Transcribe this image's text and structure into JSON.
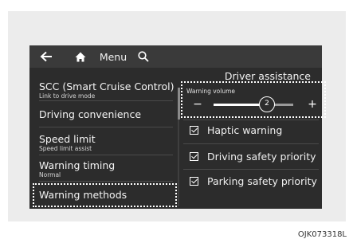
{
  "topbar": {
    "back_icon": "arrow-left-icon",
    "home_icon": "home-icon",
    "menu_label": "Menu",
    "search_icon": "search-icon"
  },
  "page_title": "Driver assistance",
  "left_menu": {
    "items": [
      {
        "title": "SCC (Smart Cruise Control)",
        "subtitle": "Link to drive mode"
      },
      {
        "title": "Driving convenience",
        "subtitle": ""
      },
      {
        "title": "Speed limit",
        "subtitle": "Speed limit assist"
      },
      {
        "title": "Warning timing",
        "subtitle": "Normal"
      },
      {
        "title": "Warning methods",
        "subtitle": ""
      }
    ],
    "selected": "Warning methods"
  },
  "warning_volume": {
    "label": "Warning volume",
    "minus": "−",
    "plus": "+",
    "value": "2",
    "level_fraction": 0.67
  },
  "options": [
    {
      "label": "Haptic warning",
      "checked": true
    },
    {
      "label": "Driving safety priority",
      "checked": true
    },
    {
      "label": "Parking safety priority",
      "checked": true
    }
  ],
  "caption": "OJK073318L",
  "colors": {
    "screen_bg": "#2c2c2c",
    "topbar_bg": "#3a3a3a",
    "text": "#f0f0f0",
    "frame_bg": "#ececec"
  }
}
